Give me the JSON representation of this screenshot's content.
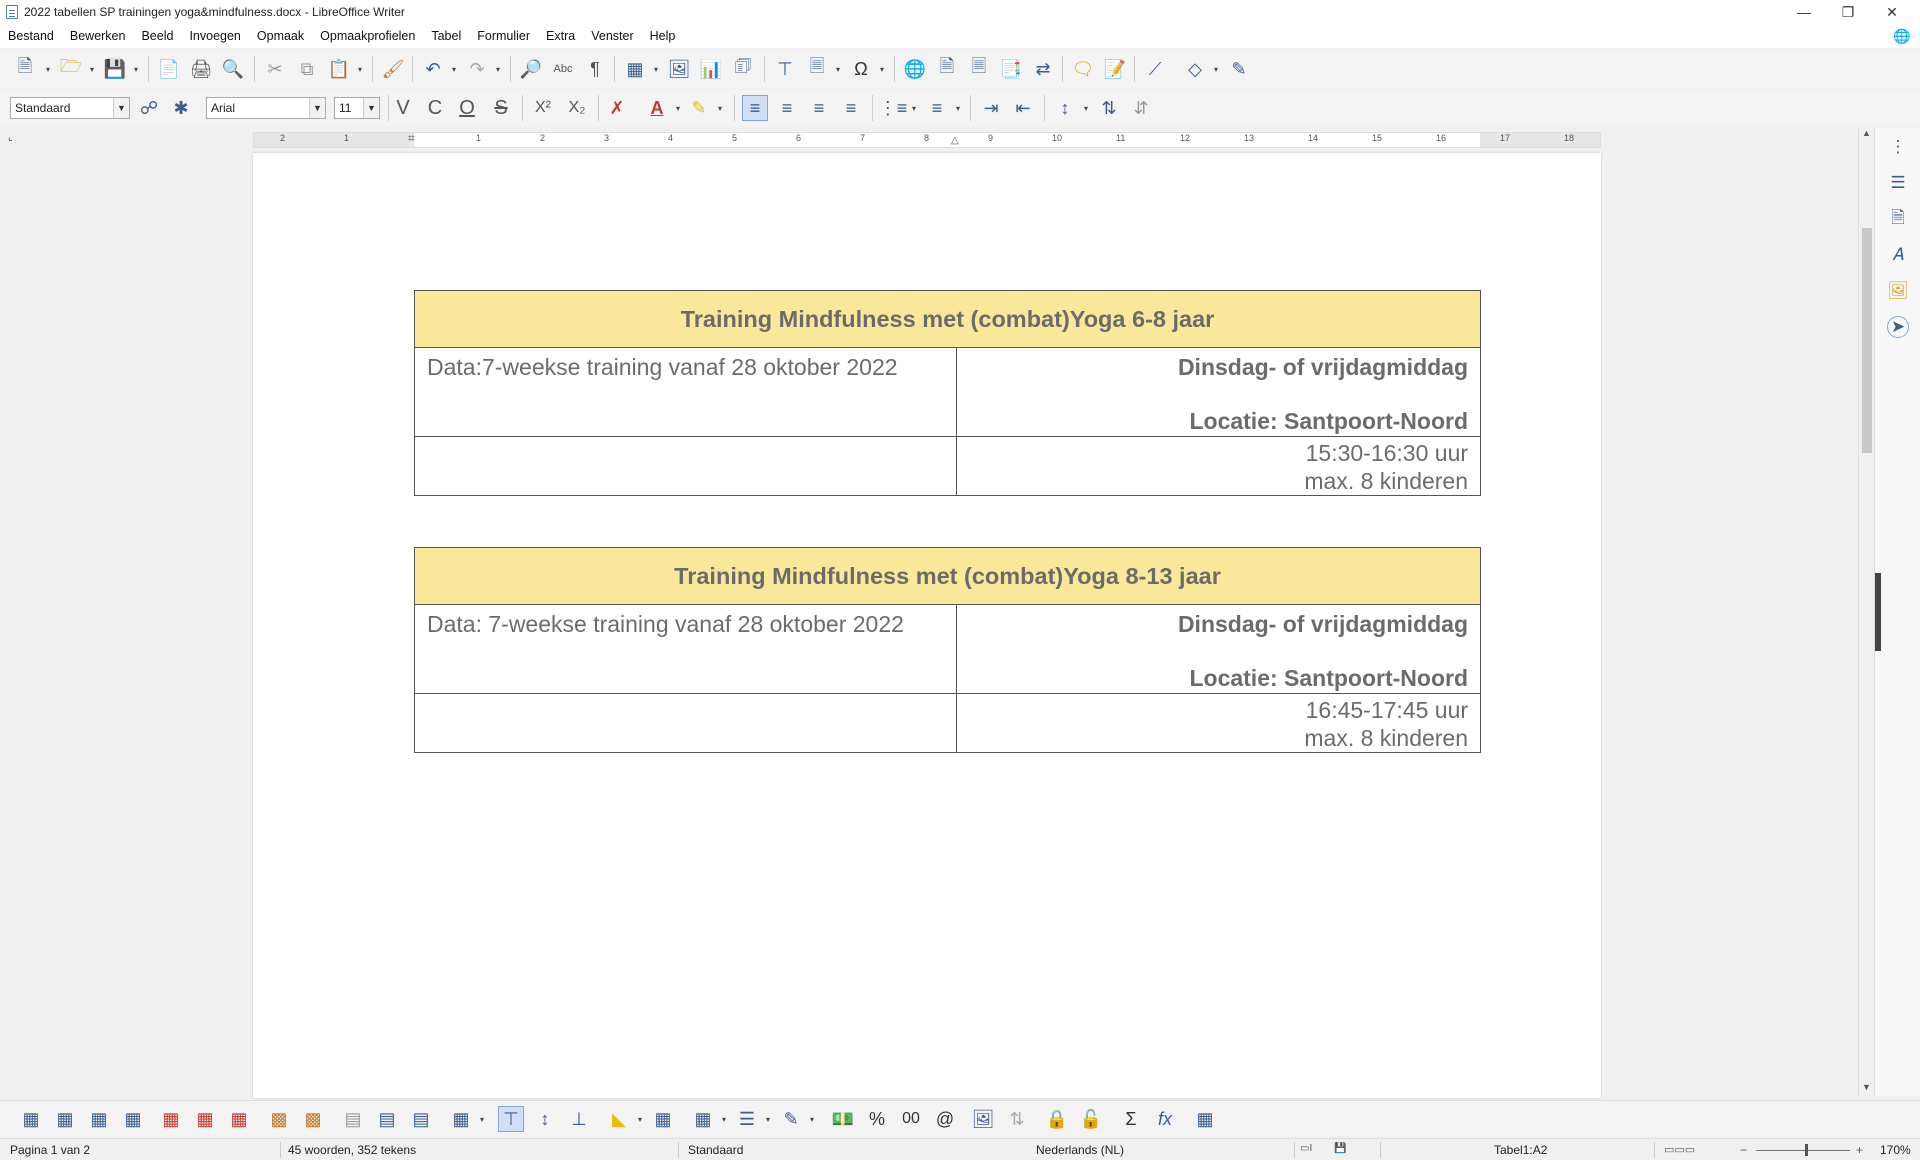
{
  "window": {
    "title": "2022 tabellen SP trainingen yoga&mindfulness.docx - LibreOffice Writer"
  },
  "menu": [
    "Bestand",
    "Bewerken",
    "Beeld",
    "Invoegen",
    "Opmaak",
    "Opmaakprofielen",
    "Tabel",
    "Formulier",
    "Extra",
    "Venster",
    "Help"
  ],
  "format": {
    "style": "Standaard",
    "font": "Arial",
    "size": "11"
  },
  "ruler": [
    "2",
    "1",
    "1",
    "2",
    "3",
    "4",
    "5",
    "6",
    "7",
    "8",
    "9",
    "10",
    "11",
    "12",
    "13",
    "14",
    "15",
    "16",
    "17",
    "18"
  ],
  "tables": [
    {
      "heading": "Training Mindfulness met (combat)Yoga 6-8 jaar",
      "data": "Data:7-weekse training vanaf 28 oktober 2022",
      "day": "Dinsdag- of vrijdagmiddag",
      "location": "Locatie: Santpoort-Noord",
      "time": "15:30-16:30 uur",
      "max": "max. 8 kinderen"
    },
    {
      "heading": "Training Mindfulness met (combat)Yoga 8-13 jaar",
      "data": "Data: 7-weekse training vanaf 28 oktober 2022",
      "day": "Dinsdag- of vrijdagmiddag",
      "location": "Locatie: Santpoort-Noord",
      "time": "16:45-17:45 uur",
      "max": "max. 8 kinderen"
    }
  ],
  "status": {
    "page": "Pagina 1 van 2",
    "words": "45 woorden, 352 tekens",
    "style": "Standaard",
    "language": "Nederlands (NL)",
    "cell": "Tabel1:A2",
    "zoom": "170%"
  },
  "toolbar_glyphs": {
    "bold": "V",
    "italic": "C",
    "underline": "O",
    "strike": "S",
    "superscript": "X²",
    "subscript": "X₂",
    "percent": "%",
    "decimal": "00",
    "at": "@",
    "sum": "Σ",
    "formula": "fx"
  },
  "colors": {
    "table_header": "#fae89a",
    "text": "#6b6b6b",
    "accent": "#3d5d8a"
  }
}
